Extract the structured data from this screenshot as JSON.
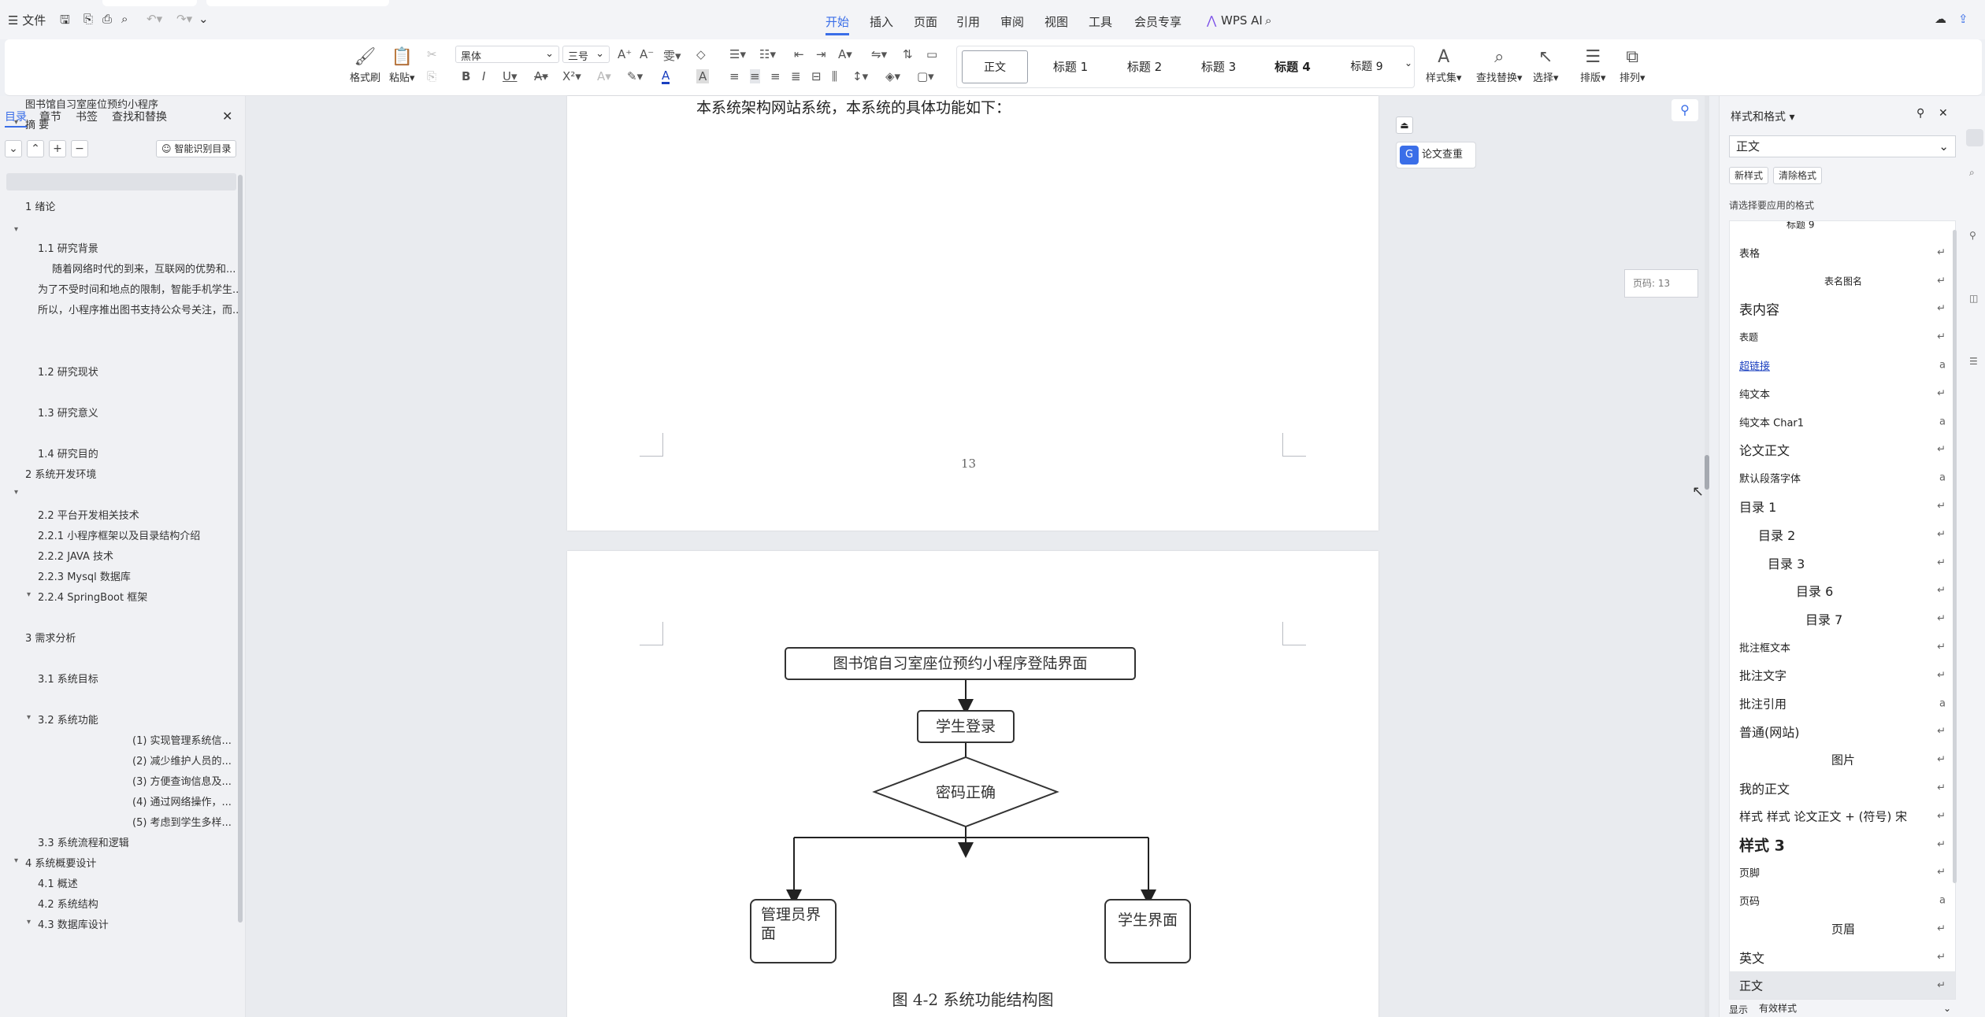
{
  "topbar": {
    "file_label": "☰ 文件",
    "menu_tabs": [
      "开始",
      "插入",
      "页面",
      "引用",
      "审阅",
      "视图",
      "工具",
      "会员专享"
    ],
    "wps_ai": "WPS AI"
  },
  "ribbon": {
    "format_painter": "格式刷",
    "paste": "粘贴",
    "font_name": "黑体",
    "font_size": "三号",
    "styles": [
      "正文",
      "标题 1",
      "标题 2",
      "标题 3",
      "标题 4",
      "标题 9"
    ],
    "style_set": "样式集",
    "find_replace": "查找替换",
    "select": "选择",
    "layout": "排版",
    "arrange": "排列"
  },
  "sidebar": {
    "tabs": [
      "目录",
      "章节",
      "书签",
      "查找和替换"
    ],
    "smart_toc": "智能识别目录",
    "toc_items": [
      {
        "text": "图书馆自习室座位预约小程序",
        "indent": 0
      },
      {
        "text": "摘 要",
        "indent": 0
      },
      {
        "text": "1 绪论",
        "indent": 0
      },
      {
        "text": "1.1 研究背景",
        "indent": 1
      },
      {
        "text": "随着网络时代的到来，互联网的优势和...",
        "indent": 2
      },
      {
        "text": "为了不受时间和地点的限制，智能手机学生...",
        "indent": 1
      },
      {
        "text": "所以，小程序推出图书支持公众号关注，而...",
        "indent": 1
      },
      {
        "text": "1.2 研究现状",
        "indent": 1
      },
      {
        "text": "1.3 研究意义",
        "indent": 1
      },
      {
        "text": "1.4 研究目的",
        "indent": 1
      },
      {
        "text": "2 系统开发环境",
        "indent": 0
      },
      {
        "text": "2.2 平台开发相关技术",
        "indent": 1
      },
      {
        "text": "2.2.1 小程序框架以及目录结构介绍",
        "indent": 1
      },
      {
        "text": "2.2.2 JAVA 技术",
        "indent": 1
      },
      {
        "text": "2.2.3 Mysql 数据库",
        "indent": 1
      },
      {
        "text": "2.2.4 SpringBoot 框架",
        "indent": 1
      },
      {
        "text": "3 需求分析",
        "indent": 0
      },
      {
        "text": "3.1 系统目标",
        "indent": 1
      },
      {
        "text": "3.2 系统功能",
        "indent": 1
      },
      {
        "text": "(1) 实现管理系统信...",
        "indent": 3
      },
      {
        "text": "(2) 减少维护人员的...",
        "indent": 3
      },
      {
        "text": "(3) 方便查询信息及...",
        "indent": 3
      },
      {
        "text": "(4) 通过网络操作，...",
        "indent": 3
      },
      {
        "text": "(5) 考虑到学生多样...",
        "indent": 3
      },
      {
        "text": "3.3 系统流程和逻辑",
        "indent": 1
      },
      {
        "text": "4 系统概要设计",
        "indent": 0
      },
      {
        "text": "4.1 概述",
        "indent": 1
      },
      {
        "text": "4.2 系统结构",
        "indent": 1
      },
      {
        "text": "4.3 数据库设计",
        "indent": 1
      }
    ]
  },
  "document": {
    "top_text": "本系统架构网站系统，本系统的具体功能如下：",
    "page_number": "13",
    "page_badge": "页码: 13",
    "plagiarism_check": "论文查重",
    "flowchart": {
      "title_box": "图书馆自习室座位预约小程序登陆界面",
      "login_box": "学生登录",
      "decision": "密码正确",
      "admin_box": "管理员界面",
      "student_box": "学生界面"
    },
    "caption": "图 4-2 系统功能结构图"
  },
  "right_panel": {
    "title": "样式和格式",
    "current_style": "正文",
    "new_style": "新样式",
    "clear_format": "清除格式",
    "hint": "请选择要应用的格式",
    "items": [
      {
        "text": "标题 9",
        "mark": ""
      },
      {
        "text": "表格",
        "mark": "↵"
      },
      {
        "text": "表名图名",
        "mark": "↵"
      },
      {
        "text": "表内容",
        "mark": "↵"
      },
      {
        "text": "表题",
        "mark": "↵"
      },
      {
        "text": "超链接",
        "mark": "a"
      },
      {
        "text": "纯文本",
        "mark": "↵"
      },
      {
        "text": "纯文本 Char1",
        "mark": "a"
      },
      {
        "text": "论文正文",
        "mark": "↵"
      },
      {
        "text": "默认段落字体",
        "mark": "a"
      },
      {
        "text": "目录 1",
        "mark": "↵"
      },
      {
        "text": "目录 2",
        "mark": "↵"
      },
      {
        "text": "目录 3",
        "mark": "↵"
      },
      {
        "text": "目录 6",
        "mark": "↵"
      },
      {
        "text": "目录 7",
        "mark": "↵"
      },
      {
        "text": "批注框文本",
        "mark": "↵"
      },
      {
        "text": "批注文字",
        "mark": "↵"
      },
      {
        "text": "批注引用",
        "mark": "a"
      },
      {
        "text": "普通(网站)",
        "mark": "↵"
      },
      {
        "text": "图片",
        "mark": "↵"
      },
      {
        "text": "我的正文",
        "mark": "↵"
      },
      {
        "text": "样式 样式 论文正文 + (符号) 宋",
        "mark": "↵"
      },
      {
        "text": "样式 3",
        "mark": "↵"
      },
      {
        "text": "页脚",
        "mark": "↵"
      },
      {
        "text": "页码",
        "mark": "a"
      },
      {
        "text": "页眉",
        "mark": "↵"
      },
      {
        "text": "英文",
        "mark": "↵"
      },
      {
        "text": "正文",
        "mark": "↵"
      }
    ],
    "display_label": "显示",
    "display_value": "有效样式"
  },
  "colors": {
    "accent": "#3a6ee8",
    "hyperlink": "#1a3fbf"
  }
}
